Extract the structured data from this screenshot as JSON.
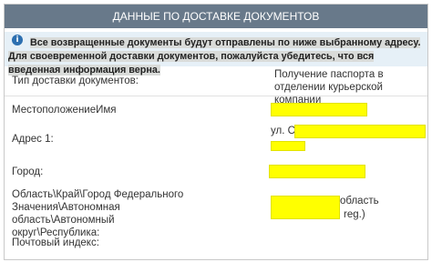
{
  "header": {
    "title": "ДАННЫЕ ПО ДОСТАВКЕ ДОКУМЕНТОВ"
  },
  "notice": {
    "icon": "info-icon",
    "text_highlight": "Все возвращенные документы будут отправлены по ниже выбранному адресу. Для своевременной доставки документов, пожалуйста убедитесь, что вся введенная информация верна."
  },
  "fields": {
    "delivery_type": {
      "label": "Тип доставки документов:",
      "value": "Получение паспорта в отделении курьерской компании"
    },
    "location": {
      "label": "МестоположениеИмя"
    },
    "address1": {
      "label": "Адрес 1:",
      "value_prefix": "ул. С"
    },
    "city": {
      "label": "Город:"
    },
    "region": {
      "label": "Область\\Край\\Город Федерального Значения\\Автономная область\\Автономный округ\\Республика:",
      "value_suffix_1": "область",
      "value_suffix_2": "reg.)"
    },
    "postal": {
      "label": "Почтовый индекс:"
    }
  },
  "colors": {
    "header_bg": "#68798a",
    "notice_bg": "#e6f0f7",
    "redaction": "#ffff00"
  }
}
